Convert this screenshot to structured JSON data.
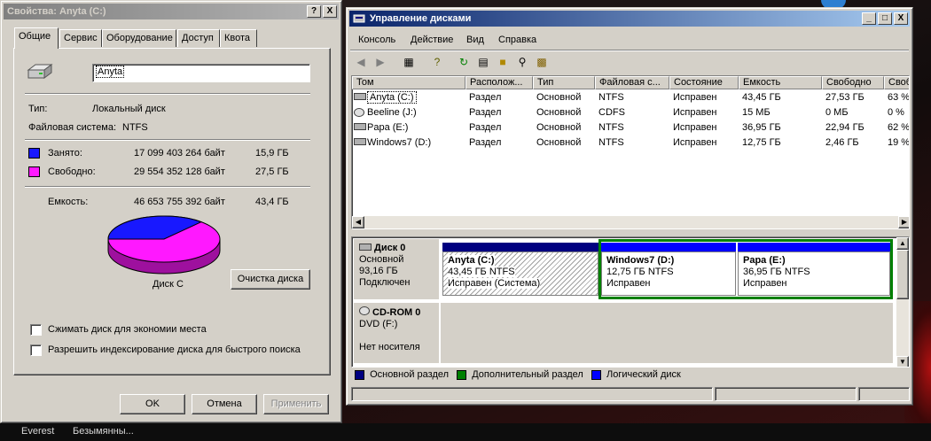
{
  "taskbar": {
    "items": [
      "Everest",
      "Безымянны..."
    ]
  },
  "properties": {
    "title": "Свойства: Anyta (C:)",
    "help_glyph": "?",
    "close_glyph": "X",
    "tabs": [
      "Общие",
      "Сервис",
      "Оборудование",
      "Доступ",
      "Квота"
    ],
    "drive_name": "Anyta",
    "type_label": "Тип:",
    "type_value": "Локальный диск",
    "fs_label": "Файловая система:",
    "fs_value": "NTFS",
    "used_label": "Занято:",
    "used_bytes": "17 099 403 264 байт",
    "used_gb": "15,9 ГБ",
    "free_label": "Свободно:",
    "free_bytes": "29 554 352 128 байт",
    "free_gb": "27,5 ГБ",
    "capacity_label": "Емкость:",
    "capacity_bytes": "46 653 755 392 байт",
    "capacity_gb": "43,4 ГБ",
    "disk_label": "Диск C",
    "cleanup_button": "Очистка диска",
    "compress_label": "Сжимать диск для экономии места",
    "index_label": "Разрешить индексирование диска для быстрого поиска",
    "ok_button": "OK",
    "cancel_button": "Отмена",
    "apply_button": "Применить",
    "colors": {
      "used": "#1818ff",
      "free": "#ff18ff"
    },
    "used_fraction": 0.366
  },
  "diskmgmt": {
    "title": "Управление дисками",
    "window_buttons": [
      "_",
      "□",
      "X"
    ],
    "menu": [
      "Консоль",
      "Действие",
      "Вид",
      "Справка"
    ],
    "toolbar_icons": [
      "back-arrow-icon",
      "forward-arrow-icon",
      "show-hide-tree-icon",
      "help-icon",
      "refresh-icon",
      "properties-icon",
      "open-folder-icon",
      "search-icon",
      "export-icon"
    ],
    "columns": [
      "Том",
      "Располож...",
      "Тип",
      "Файловая с...",
      "Состояние",
      "Емкость",
      "Свободно",
      "Своб"
    ],
    "volumes": [
      {
        "name": "Anyta (C:)",
        "layout": "Раздел",
        "type": "Основной",
        "fs": "NTFS",
        "status": "Исправен",
        "capacity": "43,45 ГБ",
        "free": "27,53 ГБ",
        "pct": "63 %",
        "icon": "disk-drive-icon",
        "selected": true
      },
      {
        "name": "Beeline (J:)",
        "layout": "Раздел",
        "type": "Основной",
        "fs": "CDFS",
        "status": "Исправен",
        "capacity": "15 МБ",
        "free": "0 МБ",
        "pct": "0 %",
        "icon": "cd-drive-icon",
        "selected": false
      },
      {
        "name": "Papa (E:)",
        "layout": "Раздел",
        "type": "Основной",
        "fs": "NTFS",
        "status": "Исправен",
        "capacity": "36,95 ГБ",
        "free": "22,94 ГБ",
        "pct": "62 %",
        "icon": "disk-drive-icon",
        "selected": false
      },
      {
        "name": "Windows7 (D:)",
        "layout": "Раздел",
        "type": "Основной",
        "fs": "NTFS",
        "status": "Исправен",
        "capacity": "12,75 ГБ",
        "free": "2,46 ГБ",
        "pct": "19 %",
        "icon": "disk-drive-icon",
        "selected": false
      }
    ],
    "disk0": {
      "name": "Диск 0",
      "kind": "Основной",
      "size": "93,16 ГБ",
      "state": "Подключен",
      "partitions": [
        {
          "name": "Anyta  (C:)",
          "size": "43,45 ГБ NTFS",
          "status": "Исправен (Система)"
        },
        {
          "name": "Windows7  (D:)",
          "size": "12,75 ГБ NTFS",
          "status": "Исправен"
        },
        {
          "name": "Papa  (E:)",
          "size": "36,95 ГБ NTFS",
          "status": "Исправен"
        }
      ]
    },
    "cdrom0": {
      "name": "CD-ROM 0",
      "drive": "DVD (F:)",
      "state": "Нет носителя"
    },
    "legend": [
      {
        "label": "Основной раздел",
        "color": "#000080"
      },
      {
        "label": "Дополнительный раздел",
        "color": "#008000"
      },
      {
        "label": "Логический диск",
        "color": "#0000ff"
      }
    ]
  }
}
